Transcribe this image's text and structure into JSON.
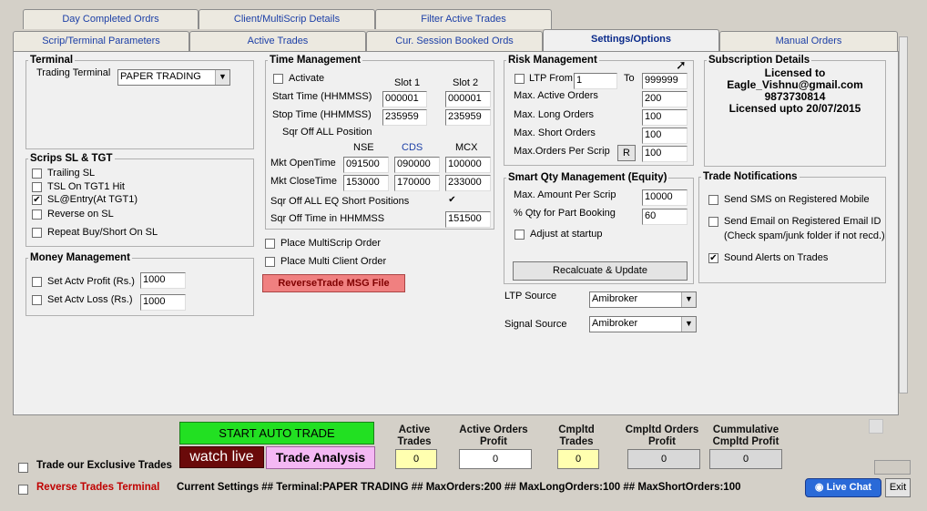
{
  "tabs_row1": [
    "Day Completed Ordrs",
    "Client/MultiScrip Details",
    "Filter Active Trades"
  ],
  "tabs_row2": [
    "Scrip/Terminal Parameters",
    "Active Trades",
    "Cur. Session Booked Ords",
    "Settings/Options",
    "Manual Orders"
  ],
  "terminal": {
    "legend": "Terminal",
    "label": "Trading  Terminal",
    "value": "PAPER TRADING"
  },
  "scrips": {
    "legend": "Scrips SL & TGT",
    "items": [
      "Trailing SL",
      "TSL On TGT1 Hit",
      "SL@Entry(At TGT1)",
      "Reverse on SL",
      "Repeat Buy/Short On SL"
    ],
    "checked": [
      false,
      false,
      true,
      false,
      false
    ]
  },
  "money": {
    "legend": "Money Management",
    "profit_label": "Set Actv Profit (Rs.)",
    "profit_value": "1000",
    "loss_label": "Set Actv Loss (Rs.)",
    "loss_value": "1000"
  },
  "time": {
    "legend": "Time Management",
    "activate": "Activate",
    "slot1": "Slot 1",
    "slot2": "Slot 2",
    "start_label": "Start Time (HHMMSS)",
    "start1": "000001",
    "start2": "000001",
    "stop_label": "Stop Time (HHMMSS)",
    "stop1": "235959",
    "stop2": "235959",
    "sqroff_label": "Sqr Off ALL Position",
    "nse": "NSE",
    "cds": "CDS",
    "mcx": "MCX",
    "open_label": "Mkt OpenTime",
    "open_nse": "091500",
    "open_cds": "090000",
    "open_mcx": "100000",
    "close_label": "Mkt CloseTime",
    "close_nse": "153000",
    "close_cds": "170000",
    "close_mcx": "233000",
    "eq_short_label": "Sqr Off ALL EQ Short Positions",
    "eq_short_checked": "✔",
    "sqoff_time_label": "Sqr Off Time in HHMMSS",
    "sqoff_time": "151500"
  },
  "multiscrip": "Place MultiScrip Order",
  "multiclient": "Place Multi Client Order",
  "reverse_msg_btn": "ReverseTrade MSG File",
  "risk": {
    "legend": "Risk Management",
    "ltp_from": "LTP From",
    "ltp_from_val": "1",
    "to": "To",
    "to_val": "999999",
    "max_active_label": "Max. Active Orders",
    "max_active": "200",
    "max_long_label": "Max. Long Orders",
    "max_long": "100",
    "max_short_label": "Max. Short Orders",
    "max_short": "100",
    "per_scrip_label": "Max.Orders Per Scrip",
    "per_scrip_btn": "R",
    "per_scrip": "100"
  },
  "smart": {
    "legend": "Smart Qty Management (Equity)",
    "amount_label": "Max. Amount Per Scrip",
    "amount": "10000",
    "part_label": "% Qty for Part Booking",
    "part": "60",
    "adjust": "Adjust at startup",
    "recalc": "Recalcuate & Update"
  },
  "ltp_source": {
    "label": "LTP Source",
    "value": "Amibroker"
  },
  "signal_source": {
    "label": "Signal Source",
    "value": "Amibroker"
  },
  "subscription": {
    "legend": "Subscription Details",
    "lines": [
      "Licensed to",
      "Eagle_Vishnu@gmail.com",
      "9873730814",
      "Licensed upto 20/07/2015"
    ]
  },
  "notifications": {
    "legend": "Trade Notifications",
    "sms": "Send SMS on Registered Mobile",
    "email": "Send Email on Registered Email ID",
    "email_note": "(Check spam/junk folder if not recd.)",
    "sound": "Sound Alerts on Trades"
  },
  "bottom": {
    "start_btn": "START AUTO TRADE",
    "watch_btn": "watch live",
    "analysis_btn": "Trade Analysis",
    "exclusive": "Trade our Exclusive Trades",
    "active_trades_label": "Active Trades",
    "active_trades": "0",
    "active_profit_label": "Active Orders Profit",
    "active_profit": "0",
    "cmpltd_trades_label": "Cmpltd Trades",
    "cmpltd_trades": "0",
    "cmpltd_profit_label": "Cmpltd Orders Profit",
    "cmpltd_profit": "0",
    "cum_profit_label": "Cummulative Cmpltd Profit",
    "cum_profit": "0",
    "reverse_terminal": "Reverse Trades Terminal",
    "current_settings": "Current Settings ## Terminal:PAPER TRADING ## MaxOrders:200 ## MaxLongOrders:100 ## MaxShortOrders:100",
    "live_chat": "Live Chat",
    "exit": "Exit"
  }
}
